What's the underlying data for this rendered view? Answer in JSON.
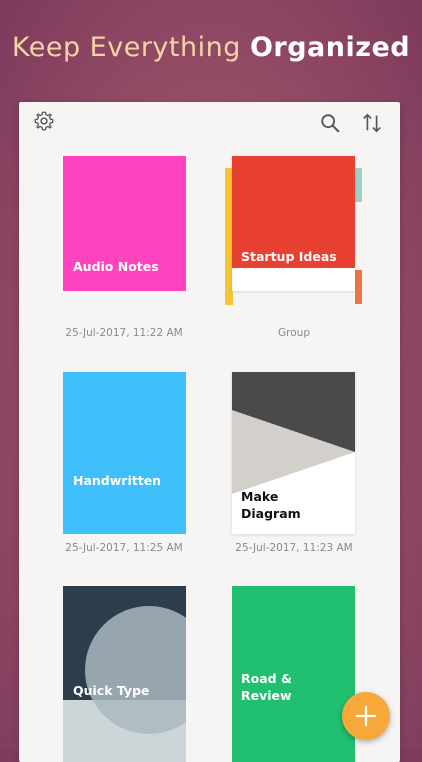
{
  "headline": {
    "light": "Keep Everything",
    "bold": "Organized"
  },
  "toolbar": {
    "icons": [
      "gear-icon",
      "search-icon",
      "sort-icon"
    ]
  },
  "notes": [
    {
      "title": "Audio Notes",
      "date": "25-Jul-2017, 11:22 AM",
      "color": "#ff44c0"
    },
    {
      "title": "Startup Ideas",
      "date": "Group",
      "color": "#e84132"
    },
    {
      "title": "Handwritten",
      "date": "25-Jul-2017, 11:25 AM",
      "color": "#40c0fa"
    },
    {
      "title": "Make Diagram",
      "date": "25-Jul-2017, 11:23 AM",
      "color": "#4a4a4a"
    },
    {
      "title": "Quick Type",
      "date": "",
      "color": "#2c3e4c"
    },
    {
      "title": "Road & Review",
      "date": "",
      "color": "#20c070"
    }
  ],
  "fab": {
    "icon": "plus-icon",
    "color": "#f6a93a"
  }
}
